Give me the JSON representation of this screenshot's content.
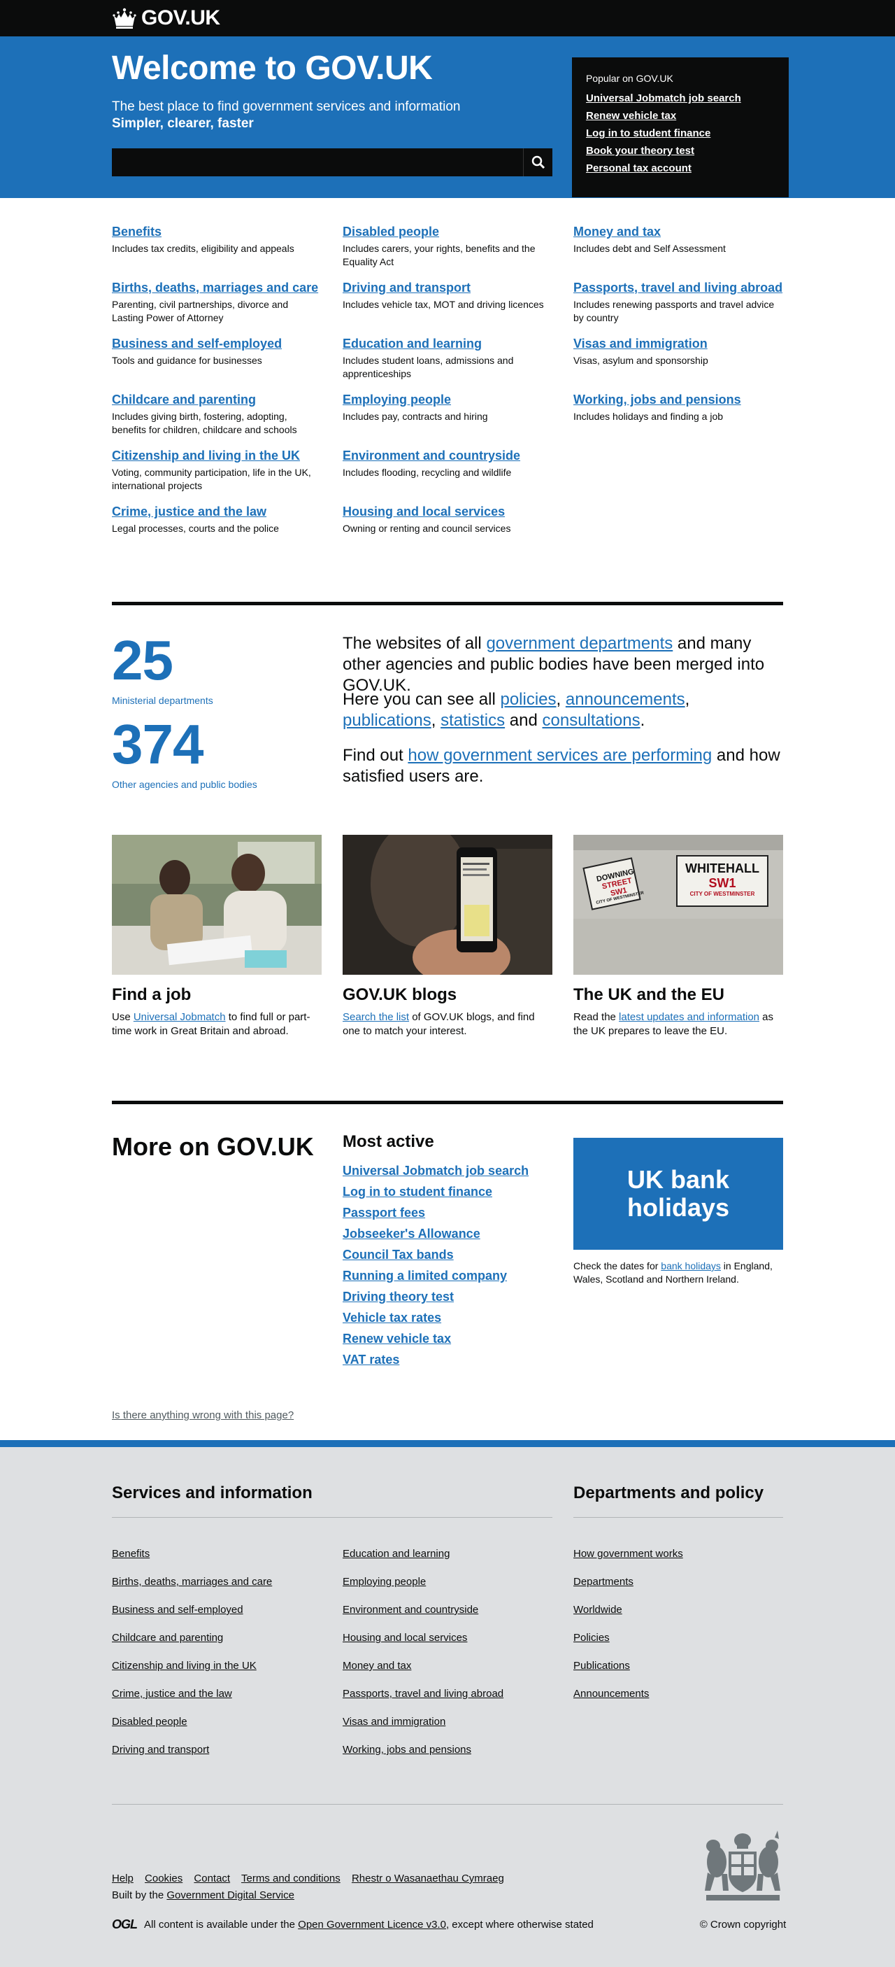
{
  "header": {
    "logo_text": "GOV.UK"
  },
  "hero": {
    "title": "Welcome to GOV.UK",
    "subtitle": "The best place to find government services and information",
    "tagline": "Simpler, clearer, faster",
    "search": {
      "placeholder": "",
      "button_icon": "search-icon"
    }
  },
  "popular": {
    "heading": "Popular on GOV.UK",
    "links": [
      "Universal Jobmatch job search",
      "Renew vehicle tax",
      "Log in to student finance",
      "Book your theory test",
      "Personal tax account"
    ]
  },
  "topics": [
    {
      "title": "Benefits",
      "desc": "Includes tax credits, eligibility and appeals"
    },
    {
      "title": "Disabled people",
      "desc": "Includes carers, your rights, benefits and the Equality Act"
    },
    {
      "title": "Money and tax",
      "desc": "Includes debt and Self Assessment"
    },
    {
      "title": "Births, deaths, marriages and care",
      "desc": "Parenting, civil partnerships, divorce and Lasting Power of Attorney"
    },
    {
      "title": "Driving and transport",
      "desc": "Includes vehicle tax, MOT and driving licences"
    },
    {
      "title": "Passports, travel and living abroad",
      "desc": "Includes renewing passports and travel advice by country"
    },
    {
      "title": "Business and self-employed",
      "desc": "Tools and guidance for businesses"
    },
    {
      "title": "Education and learning",
      "desc": "Includes student loans, admissions and apprenticeships"
    },
    {
      "title": "Visas and immigration",
      "desc": "Visas, asylum and sponsorship"
    },
    {
      "title": "Childcare and parenting",
      "desc": "Includes giving birth, fostering, adopting, benefits for children, childcare and schools"
    },
    {
      "title": "Employing people",
      "desc": "Includes pay, contracts and hiring"
    },
    {
      "title": "Working, jobs and pensions",
      "desc": "Includes holidays and finding a job"
    },
    {
      "title": "Citizenship and living in the UK",
      "desc": "Voting, community participation, life in the UK, international projects"
    },
    {
      "title": "Environment and countryside",
      "desc": "Includes flooding, recycling and wildlife"
    },
    {
      "title": "Crime, justice and the law",
      "desc": "Legal processes, courts and the police"
    },
    {
      "title": "Housing and local services",
      "desc": "Owning or renting and council services"
    }
  ],
  "stats": {
    "ministerial_count": "25",
    "ministerial_label": "Ministerial departments",
    "other_count": "374",
    "other_label": "Other agencies and public bodies",
    "para1_pre": "The websites of all ",
    "para1_link": "government departments",
    "para1_post": " and many other agencies and public bodies have been merged into GOV.UK.",
    "para2_pre": "Here you can see all ",
    "para2_links": [
      "policies",
      "announcements",
      "publications",
      "statistics",
      "consultations"
    ],
    "para2_sep1": ", ",
    "para2_sep2": ", ",
    "para2_sep3": ", ",
    "para2_and": " and ",
    "para2_end": ".",
    "para3_pre": "Find out ",
    "para3_link": "how government services are performing",
    "para3_post": " and how satisfied users are."
  },
  "features": [
    {
      "title": "Find a job",
      "pre": "Use ",
      "link": "Universal Jobmatch",
      "post": " to find full or part-time work in Great Britain and abroad."
    },
    {
      "title": "GOV.UK blogs",
      "pre": "",
      "link": "Search the list",
      "post": " of GOV.UK blogs, and find one to match your interest."
    },
    {
      "title": "The UK and the EU",
      "pre": "Read the ",
      "link": "latest updates and information",
      "post": " as the UK prepares to leave the EU."
    }
  ],
  "street_signs": {
    "left_line1": "DOWNING",
    "left_line2": "STREET SW1",
    "left_line3": "CITY OF WESTMINSTER",
    "right_line1": "WHITEHALL",
    "right_line2": "SW1",
    "right_line3": "CITY OF WESTMINSTER"
  },
  "more": {
    "title": "More on GOV.UK",
    "active_title": "Most active",
    "active_links": [
      "Universal Jobmatch job search",
      "Log in to student finance",
      "Passport fees",
      "Jobseeker's Allowance",
      "Council Tax bands",
      "Running a limited company",
      "Driving theory test",
      "Vehicle tax rates",
      "Renew vehicle tax",
      "VAT rates"
    ],
    "bank_title": "UK bank holidays",
    "bank_pre": "Check the dates for ",
    "bank_link": "bank holidays",
    "bank_post": " in England, Wales, Scotland and Northern Ireland.",
    "report": "Is there anything wrong with this page?"
  },
  "footer": {
    "services_heading": "Services and information",
    "services_col1": [
      "Benefits",
      "Births, deaths, marriages and care",
      "Business and self-employed",
      "Childcare and parenting",
      "Citizenship and living in the UK",
      "Crime, justice and the law",
      "Disabled people",
      "Driving and transport"
    ],
    "services_col2": [
      "Education and learning",
      "Employing people",
      "Environment and countryside",
      "Housing and local services",
      "Money and tax",
      "Passports, travel and living abroad",
      "Visas and immigration",
      "Working, jobs and pensions"
    ],
    "dept_heading": "Departments and policy",
    "dept_links": [
      "How government works",
      "Departments",
      "Worldwide",
      "Policies",
      "Publications",
      "Announcements"
    ],
    "meta_links": [
      "Help",
      "Cookies",
      "Contact",
      "Terms and conditions",
      "Rhestr o Wasanaethau Cymraeg"
    ],
    "built_pre": "Built by the ",
    "built_link": "Government Digital Service",
    "ogl": "OGL",
    "licence_pre": "All content is available under the ",
    "licence_link": "Open Government Licence v3.0",
    "licence_post": ", except where otherwise stated",
    "copyright": "© Crown copyright"
  },
  "colors": {
    "brand_blue": "#1d70b8",
    "black": "#0b0c0c",
    "footer_bg": "#dee0e2"
  }
}
